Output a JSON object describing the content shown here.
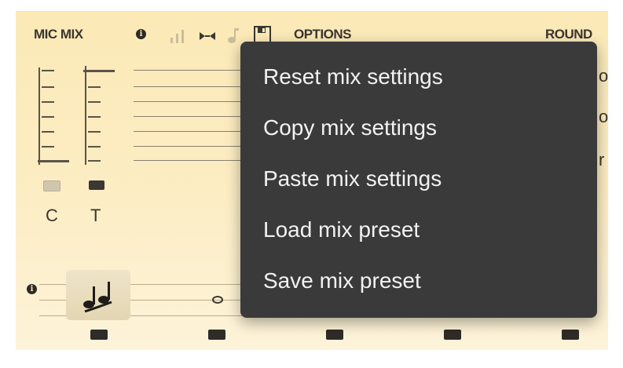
{
  "toolbar": {
    "title": "MIC MIX",
    "options_label": "OPTIONS",
    "right_label": "ROUND"
  },
  "faders": {
    "labels": [
      "C",
      "T"
    ]
  },
  "context_menu": {
    "items": [
      "Reset mix settings",
      "Copy mix settings",
      "Paste mix settings",
      "Load mix preset",
      "Save mix preset"
    ]
  },
  "right_partial_text": [
    "o",
    "o",
    "r"
  ],
  "icons": {
    "info": "info-icon",
    "levels": "signal-bars-icon",
    "swap": "swap-arrows-icon",
    "note": "music-note-icon",
    "save": "floppy-disk-icon",
    "notes_button": "double-notes-icon"
  },
  "colors": {
    "panel_bg": "#fbe9b6",
    "menu_bg": "#3a3a3a",
    "menu_text": "#f2f2f2"
  }
}
